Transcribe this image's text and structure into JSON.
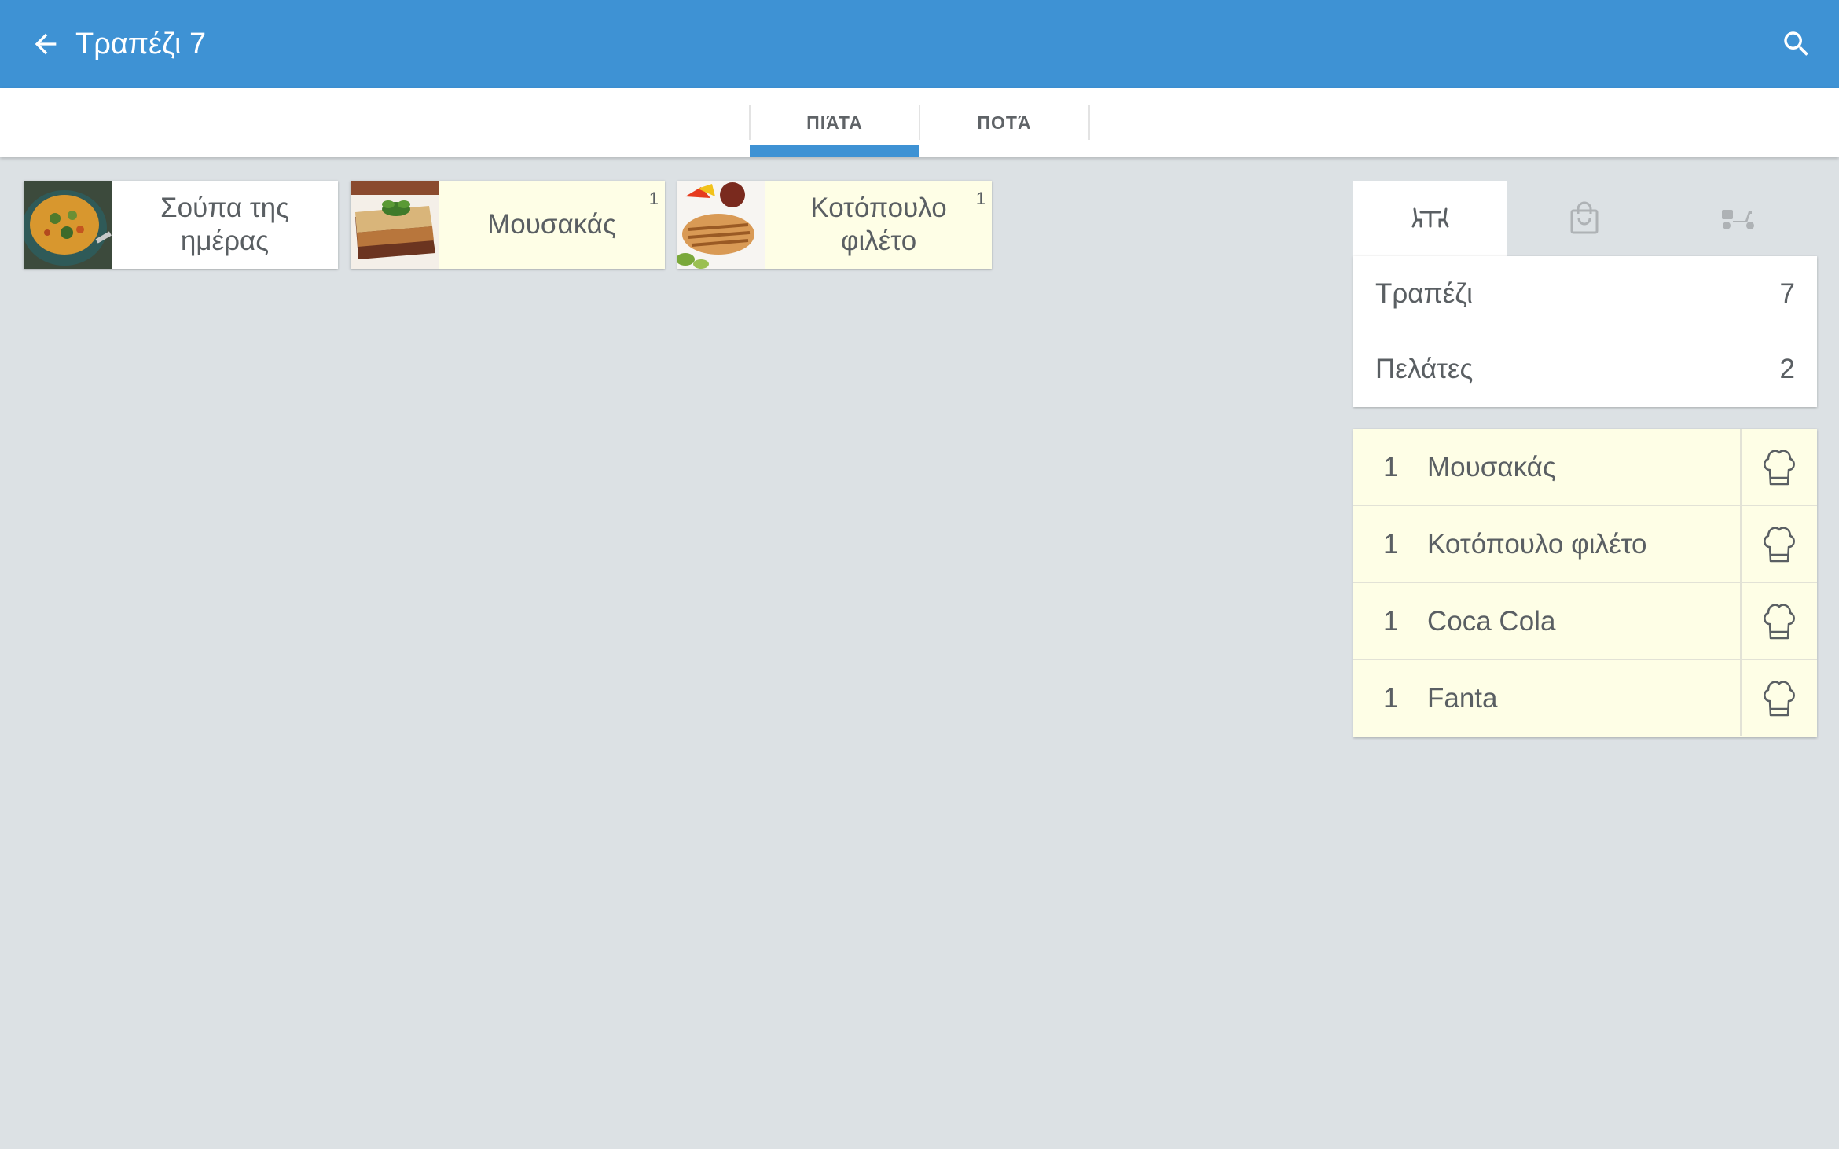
{
  "appbar": {
    "title": "Τραπέζι 7",
    "back_icon": "arrow-left-icon",
    "search_icon": "search-icon"
  },
  "tabs": [
    {
      "label": "ΠΙΆΤΑ",
      "active": true
    },
    {
      "label": "ΠΟΤΆ",
      "active": false
    }
  ],
  "products": [
    {
      "name": "Σούπα της ημέρας",
      "count": "",
      "image": "soup-image"
    },
    {
      "name": "Μουσακάς",
      "count": "1",
      "image": "moussaka-image"
    },
    {
      "name": "Κοτόπουλο φιλέτο",
      "count": "1",
      "image": "chicken-fillet-image"
    }
  ],
  "order_type_tabs": [
    {
      "icon": "dine-in-table-icon",
      "active": true
    },
    {
      "icon": "takeaway-bag-icon",
      "active": false
    },
    {
      "icon": "delivery-scooter-icon",
      "active": false
    }
  ],
  "info": {
    "table_label": "Τραπέζι",
    "table_value": "7",
    "customers_label": "Πελάτες",
    "customers_value": "2"
  },
  "order_items": [
    {
      "qty": "1",
      "name": "Μουσακάς"
    },
    {
      "qty": "1",
      "name": "Κοτόπουλο φιλέτο"
    },
    {
      "qty": "1",
      "name": "Coca Cola"
    },
    {
      "qty": "1",
      "name": "Fanta"
    }
  ],
  "colors": {
    "primary": "#3e92d4",
    "selected_bg": "#fefee6",
    "background": "#dce1e4"
  }
}
